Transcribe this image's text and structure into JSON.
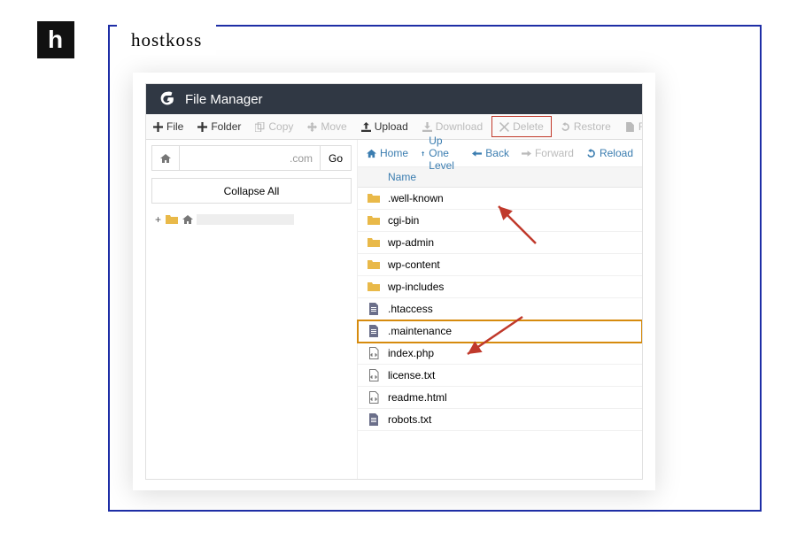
{
  "brand": {
    "mark": "h",
    "label": "hostkoss"
  },
  "titlebar": {
    "title": "File Manager"
  },
  "toolbar": {
    "file": "File",
    "folder": "Folder",
    "copy": "Copy",
    "move": "Move",
    "upload": "Upload",
    "download": "Download",
    "delete": "Delete",
    "restore": "Restore",
    "rename": "Rename"
  },
  "path": {
    "domain_suffix": ".com",
    "go": "Go"
  },
  "collapse_all": "Collapse All",
  "nav": {
    "home": "Home",
    "up": "Up One Level",
    "back": "Back",
    "forward": "Forward",
    "reload": "Reload"
  },
  "columns": {
    "name": "Name"
  },
  "files": [
    {
      "name": ".well-known",
      "type": "folder"
    },
    {
      "name": "cgi-bin",
      "type": "folder"
    },
    {
      "name": "wp-admin",
      "type": "folder"
    },
    {
      "name": "wp-content",
      "type": "folder"
    },
    {
      "name": "wp-includes",
      "type": "folder"
    },
    {
      "name": ".htaccess",
      "type": "file"
    },
    {
      "name": ".maintenance",
      "type": "file",
      "selected": true
    },
    {
      "name": "index.php",
      "type": "code"
    },
    {
      "name": "license.txt",
      "type": "code"
    },
    {
      "name": "readme.html",
      "type": "code"
    },
    {
      "name": "robots.txt",
      "type": "file"
    }
  ]
}
